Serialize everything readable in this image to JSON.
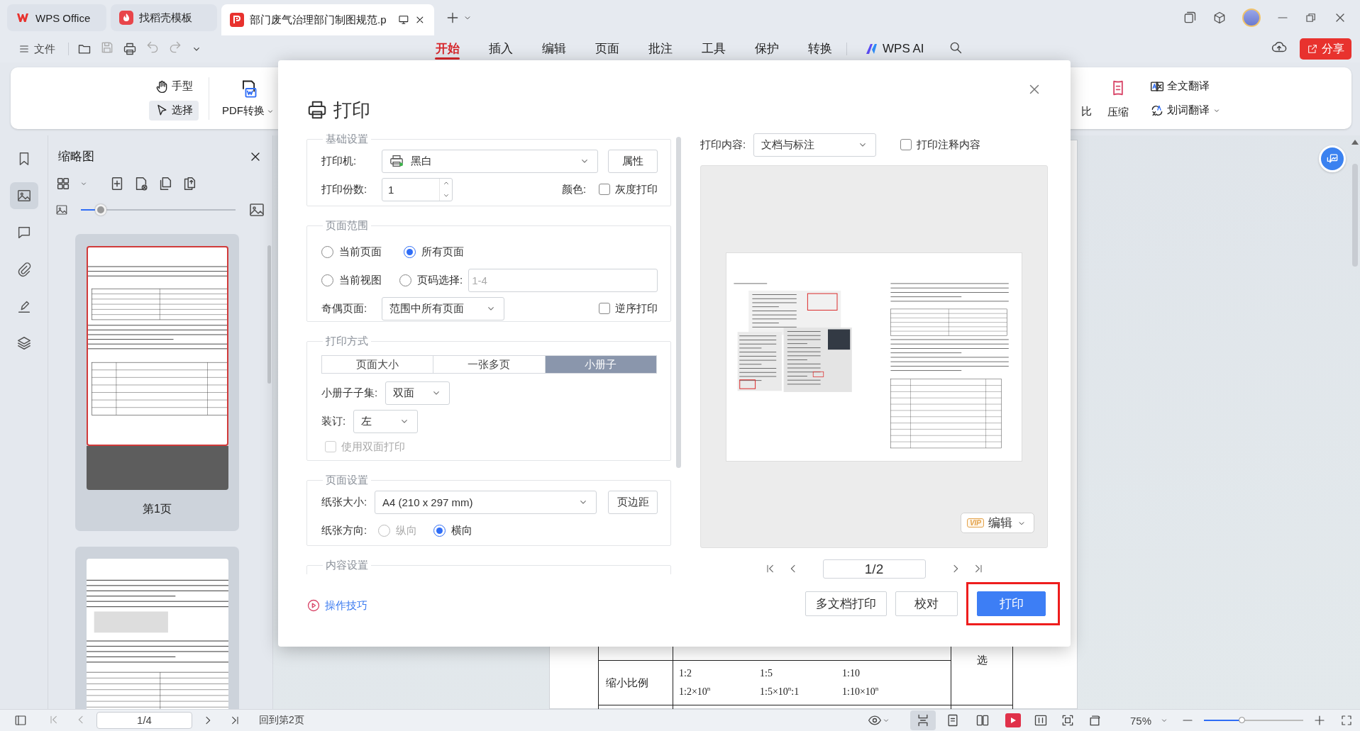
{
  "tabs": [
    {
      "label": "WPS Office",
      "kind": "wps",
      "selected": false
    },
    {
      "label": "找稻壳模板",
      "kind": "template",
      "selected": false
    },
    {
      "label": "部门废气治理部门制图规范.p",
      "kind": "pdf",
      "selected": true
    }
  ],
  "menu": {
    "file": "文件",
    "tabs": [
      {
        "label": "开始",
        "selected": true
      },
      {
        "label": "插入",
        "selected": false
      },
      {
        "label": "编辑",
        "selected": false
      },
      {
        "label": "页面",
        "selected": false
      },
      {
        "label": "批注",
        "selected": false
      },
      {
        "label": "工具",
        "selected": false
      },
      {
        "label": "保护",
        "selected": false
      },
      {
        "label": "转换",
        "selected": false
      }
    ],
    "ai": "WPS AI",
    "share": "分享"
  },
  "ribbon": {
    "tools": [
      {
        "label": "手型",
        "kind": "hand",
        "selected": false
      },
      {
        "label": "选择",
        "kind": "select",
        "selected": true
      }
    ],
    "pdf_convert": "PDF转换",
    "right": [
      {
        "label": "比",
        "kind": "compare"
      },
      {
        "label": "压缩",
        "kind": "compress"
      }
    ],
    "translate": [
      {
        "label": "全文翻译",
        "kind": "full"
      },
      {
        "label": "划词翻译",
        "kind": "word"
      }
    ]
  },
  "sidebar": {
    "items": [
      {
        "kind": "bookmark",
        "selected": false
      },
      {
        "kind": "thumbnail",
        "selected": true
      },
      {
        "kind": "comment",
        "selected": false
      },
      {
        "kind": "attachment",
        "selected": false
      },
      {
        "kind": "signature",
        "selected": false
      },
      {
        "kind": "layers",
        "selected": false
      }
    ]
  },
  "thumbnail_panel": {
    "title": "缩略图",
    "zoom": {
      "level": 0.13
    },
    "pages": [
      {
        "label": "第1页",
        "selected": true
      },
      {
        "selected": false
      }
    ]
  },
  "document": {
    "table": {
      "label": "缩小比例",
      "lines": [
        [
          "1:2",
          "1:5",
          "1:10"
        ],
        [
          "1:2×10$^{n}$",
          "1:5×10$^{n}$:1",
          "1:10×10$^{n}$"
        ]
      ],
      "side_note": "选"
    }
  },
  "print_dialog": {
    "title": "打印",
    "basic": {
      "legend": "基础设置",
      "printer_label": "打印机:",
      "printer": "黑白",
      "properties": "属性",
      "copies_label": "打印份数:",
      "copies": "1",
      "color_label": "颜色:",
      "grayscale": {
        "label": "灰度打印",
        "checked": false
      }
    },
    "range": {
      "legend": "页面范围",
      "options": [
        {
          "label": "当前页面",
          "selected": false
        },
        {
          "label": "所有页面",
          "selected": true
        },
        {
          "label": "当前视图",
          "selected": false
        },
        {
          "label": "页码选择:",
          "selected": false
        }
      ],
      "pages_placeholder": "1-4",
      "odd_even_label": "奇偶页面:",
      "odd_even": "范围中所有页面",
      "reverse": {
        "label": "逆序打印",
        "checked": false
      }
    },
    "mode": {
      "legend": "打印方式",
      "tabs": [
        {
          "label": "页面大小",
          "selected": false
        },
        {
          "label": "一张多页",
          "selected": false
        },
        {
          "label": "小册子",
          "selected": true
        }
      ],
      "subset_label": "小册子子集:",
      "subset": "双面",
      "binding_label": "装订:",
      "binding": "左",
      "duplex": {
        "label": "使用双面打印",
        "checked": false,
        "disabled": true
      }
    },
    "page_setup": {
      "legend": "页面设置",
      "size_label": "纸张大小:",
      "size": "A4 (210 x 297 mm)",
      "margins": "页边距",
      "orientation_label": "纸张方向:",
      "orientations": [
        {
          "label": "纵向",
          "selected": false,
          "disabled": true
        },
        {
          "label": "横向",
          "selected": true,
          "disabled": false
        }
      ]
    },
    "content_legend": "内容设置",
    "tips": "操作技巧",
    "content_label": "打印内容:",
    "content": "文档与标注",
    "annotations": {
      "label": "打印注释内容",
      "checked": false
    },
    "edit": {
      "badge": "VIP",
      "label": "编辑"
    },
    "page": "1/2",
    "buttons": [
      {
        "label": "多文档打印",
        "kind": "secondary",
        "highlighted": false
      },
      {
        "label": "校对",
        "kind": "secondary",
        "highlighted": false
      },
      {
        "label": "打印",
        "kind": "primary",
        "highlighted": true
      }
    ]
  },
  "status_bar": {
    "page": "1/4",
    "back": "回到第2页",
    "views": [
      {
        "kind": "scroll",
        "selected": true
      },
      {
        "kind": "single",
        "selected": false
      },
      {
        "kind": "double",
        "selected": false
      }
    ],
    "zoom": "75%",
    "zoom_slider": {
      "level": 0.38
    }
  }
}
